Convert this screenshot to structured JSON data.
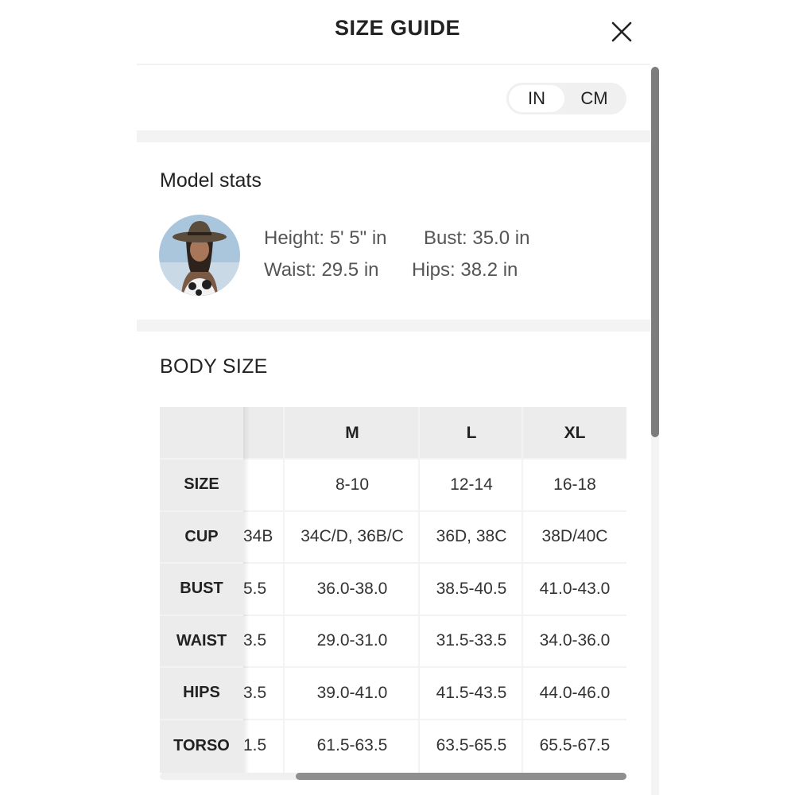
{
  "header": {
    "title": "SIZE GUIDE"
  },
  "units": {
    "in_label": "IN",
    "cm_label": "CM",
    "selected": "IN"
  },
  "model": {
    "title": "Model stats",
    "height": "Height: 5' 5\" in",
    "bust": "Bust: 35.0 in",
    "waist": "Waist: 29.5 in",
    "hips": "Hips: 38.2 in"
  },
  "body_size": {
    "title": "BODY SIZE",
    "columns": [
      "M",
      "L",
      "XL"
    ],
    "rows": [
      {
        "label": "SIZE",
        "partial": "",
        "values": [
          "8-10",
          "12-14",
          "16-18"
        ]
      },
      {
        "label": "CUP",
        "partial": "34B",
        "values": [
          "34C/D, 36B/C",
          "36D, 38C",
          "38D/40C"
        ]
      },
      {
        "label": "BUST",
        "partial": "5.5",
        "values": [
          "36.0-38.0",
          "38.5-40.5",
          "41.0-43.0"
        ]
      },
      {
        "label": "WAIST",
        "partial": "3.5",
        "values": [
          "29.0-31.0",
          "31.5-33.5",
          "34.0-36.0"
        ]
      },
      {
        "label": "HIPS",
        "partial": "3.5",
        "values": [
          "39.0-41.0",
          "41.5-43.5",
          "44.0-46.0"
        ]
      },
      {
        "label": "TORSO",
        "partial": "1.5",
        "values": [
          "61.5-63.5",
          "63.5-65.5",
          "65.5-67.5"
        ]
      }
    ]
  },
  "icons": {
    "close": "close-icon",
    "avatar": "model-avatar"
  }
}
